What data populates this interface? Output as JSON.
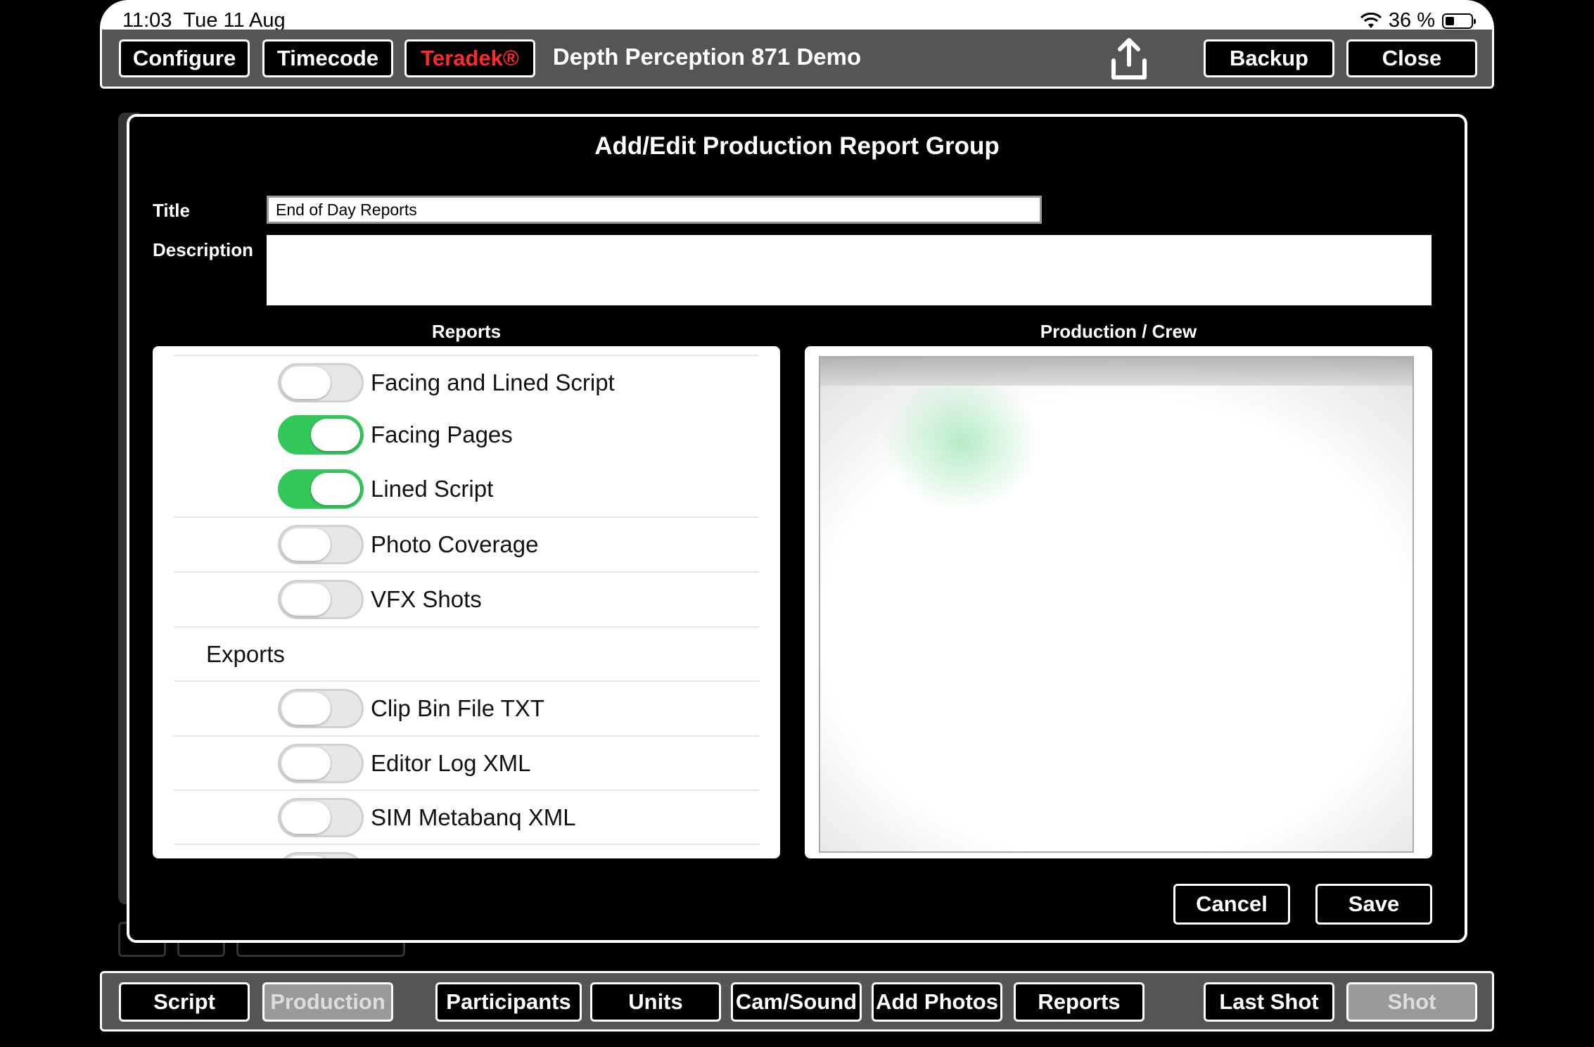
{
  "status": {
    "time": "11:03",
    "date": "Tue 11 Aug",
    "battery": "36 %"
  },
  "toolbar": {
    "configure": "Configure",
    "timecode": "Timecode",
    "teradek": "Teradek®",
    "title": "Depth Perception 871 Demo",
    "backup": "Backup",
    "close": "Close",
    "teradek_color": "#ff2a2a"
  },
  "modal": {
    "title": "Add/Edit Production Report Group",
    "title_label": "Title",
    "title_value": "End of Day Reports",
    "description_label": "Description",
    "description_value": "",
    "reports_heading": "Reports",
    "crew_heading": "Production / Crew",
    "cancel": "Cancel",
    "save": "Save"
  },
  "reports": [
    {
      "label": "Facing and Lined Script",
      "on": false
    },
    {
      "label": "Facing Pages",
      "on": true
    },
    {
      "label": "Lined Script",
      "on": true
    },
    {
      "label": "Photo Coverage",
      "on": false
    },
    {
      "label": "VFX Shots",
      "on": false
    }
  ],
  "exports_heading": "Exports",
  "exports": [
    {
      "label": "Clip Bin File TXT",
      "on": false
    },
    {
      "label": "Editor Log XML",
      "on": false
    },
    {
      "label": "SIM Metabanq XML",
      "on": false
    }
  ],
  "tabs": {
    "script": "Script",
    "production": "Production",
    "participants": "Participants",
    "units": "Units",
    "cam_sound": "Cam/Sound",
    "add_photos": "Add Photos",
    "reports": "Reports",
    "last_shot": "Last Shot",
    "shot": "Shot"
  },
  "colors": {
    "toggle_on": "#34c759",
    "toolbar_bg": "#555555",
    "active_tab": "#999999"
  }
}
